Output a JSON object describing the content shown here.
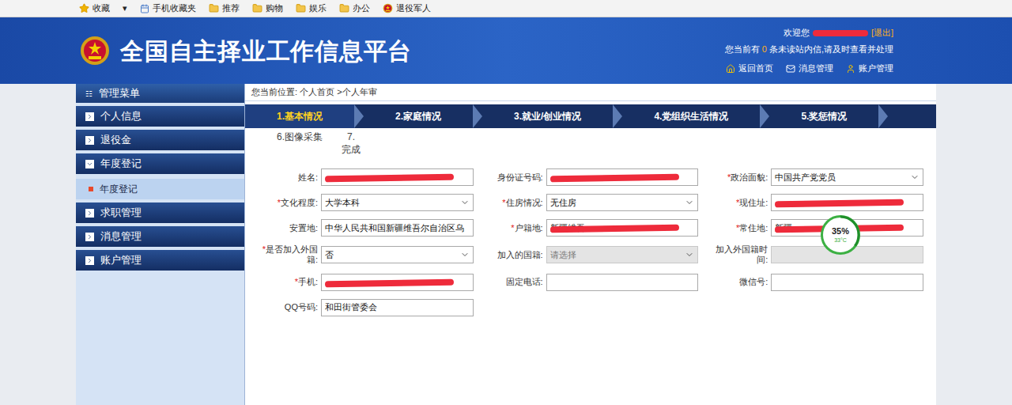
{
  "bookmarks": {
    "items": [
      {
        "label": "收藏",
        "kind": "star"
      },
      {
        "label": "▾",
        "kind": "arrow"
      },
      {
        "label": "手机收藏夹",
        "kind": "page"
      },
      {
        "label": "推荐",
        "kind": "folder"
      },
      {
        "label": "购物",
        "kind": "folder"
      },
      {
        "label": "娱乐",
        "kind": "folder"
      },
      {
        "label": "办公",
        "kind": "folder"
      },
      {
        "label": "退役军人",
        "kind": "emblem"
      }
    ]
  },
  "header": {
    "title": "全国自主择业工作信息平台",
    "welcome": "欢迎您",
    "user_redacted": true,
    "logout": "[退出]",
    "notice_prefix": "您当前有",
    "unread": "0",
    "notice_suffix": "条未读站内信,请及时查看并处理",
    "links": [
      {
        "label": "返回首页",
        "icon": "home"
      },
      {
        "label": "消息管理",
        "icon": "mail"
      },
      {
        "label": "账户管理",
        "icon": "user"
      }
    ]
  },
  "sidebar": {
    "title": "管理菜单",
    "items": [
      {
        "label": "个人信息",
        "expanded": false,
        "children": []
      },
      {
        "label": "退役金",
        "expanded": false,
        "children": []
      },
      {
        "label": "年度登记",
        "expanded": true,
        "children": [
          {
            "label": "年度登记",
            "selected": true
          }
        ]
      },
      {
        "label": "求职管理",
        "expanded": false,
        "children": []
      },
      {
        "label": "消息管理",
        "expanded": false,
        "children": []
      },
      {
        "label": "账户管理",
        "expanded": false,
        "children": []
      }
    ]
  },
  "breadcrumb": "您当前位置: 个人首页 >个人年审",
  "steps": [
    {
      "label": "1.基本情况",
      "selected": true
    },
    {
      "label": "2.家庭情况",
      "selected": false
    },
    {
      "label": "3.就业/创业情况",
      "selected": false
    },
    {
      "label": "4.党组织生活情况",
      "selected": false
    },
    {
      "label": "5.奖惩情况",
      "selected": false
    },
    {
      "label": "6.图像采集",
      "selected": false
    },
    {
      "label": "7.",
      "sub": "完成",
      "selected": false
    }
  ],
  "fields": [
    {
      "label": "姓名:",
      "required": false,
      "kind": "input",
      "value": "",
      "disabled": false,
      "redacted": true
    },
    {
      "label": "身份证号码:",
      "required": false,
      "kind": "input",
      "value": "",
      "disabled": false,
      "redacted": true
    },
    {
      "label": "政治面貌:",
      "required": true,
      "kind": "select",
      "value": "中国共产党党员",
      "disabled": false,
      "redacted": false
    },
    {
      "label": "文化程度:",
      "required": true,
      "kind": "select",
      "value": "大学本科",
      "disabled": false,
      "redacted": false
    },
    {
      "label": "住房情况:",
      "required": true,
      "kind": "select",
      "value": "无住房",
      "disabled": false,
      "redacted": false
    },
    {
      "label": "现住址:",
      "required": true,
      "kind": "input",
      "value": "",
      "disabled": false,
      "redacted": true
    },
    {
      "label": "安置地:",
      "required": false,
      "kind": "input",
      "value": "中华人民共和国新疆维吾尔自治区乌",
      "disabled": false,
      "redacted": false
    },
    {
      "label": "户籍地:",
      "required": true,
      "kind": "input",
      "value": "新疆维吾",
      "disabled": false,
      "redacted": true
    },
    {
      "label": "常住地:",
      "required": true,
      "kind": "input",
      "value": "新疆",
      "disabled": false,
      "redacted": true
    },
    {
      "label": "是否加入外国籍:",
      "required": true,
      "kind": "select",
      "value": "否",
      "disabled": false,
      "redacted": false
    },
    {
      "label": "加入的国籍:",
      "required": false,
      "kind": "select",
      "value": "请选择",
      "disabled": true,
      "redacted": false
    },
    {
      "label": "加入外国籍时间:",
      "required": false,
      "kind": "input",
      "value": "",
      "disabled": true,
      "redacted": false
    },
    {
      "label": "手机:",
      "required": true,
      "kind": "input",
      "value": "",
      "disabled": false,
      "redacted": true
    },
    {
      "label": "固定电话:",
      "required": false,
      "kind": "input",
      "value": "",
      "disabled": false,
      "redacted": false
    },
    {
      "label": "微信号:",
      "required": false,
      "kind": "input",
      "value": "",
      "disabled": false,
      "redacted": false
    },
    {
      "label": "QQ号码:",
      "required": false,
      "kind": "input",
      "value": "和田街管委会",
      "disabled": false,
      "redacted": false
    }
  ],
  "monitor": {
    "percent": "35%",
    "temp": "33°C",
    "level": 0.35
  }
}
